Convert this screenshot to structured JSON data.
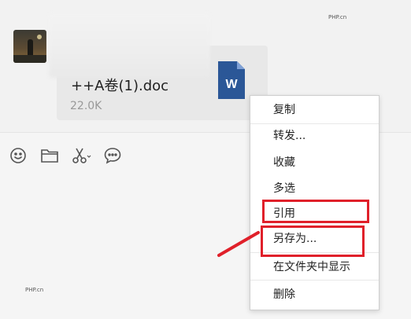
{
  "watermark": {
    "top": "PHP.cn",
    "bottom": "PHP.cn"
  },
  "message": {
    "file_name": "++A卷(1).doc",
    "file_size": "22.0K",
    "file_type_letter": "W"
  },
  "toolbar": {
    "icons": [
      "emoji-icon",
      "folder-icon",
      "scissors-icon",
      "chat-bubble-icon"
    ]
  },
  "context_menu": {
    "items": [
      "复制",
      "转发...",
      "收藏",
      "多选",
      "引用",
      "另存为...",
      "在文件夹中显示",
      "删除"
    ]
  },
  "colors": {
    "highlight": "#e0202a",
    "word_blue": "#2b5797",
    "menu_bg": "#ffffff"
  }
}
